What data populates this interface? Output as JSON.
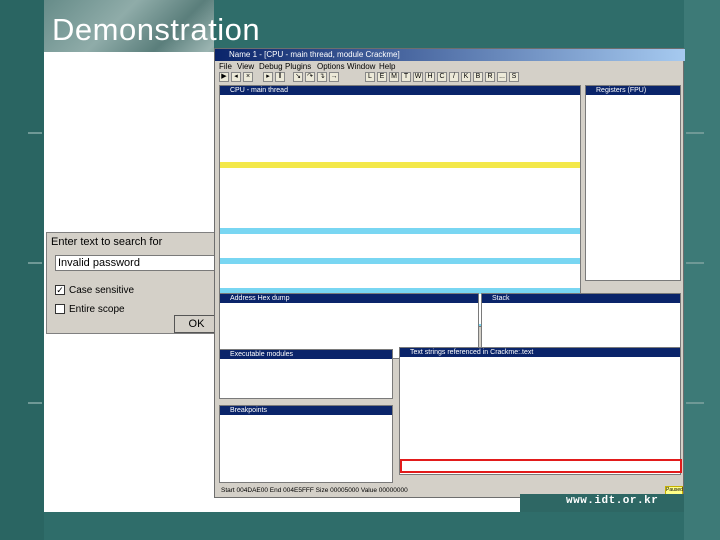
{
  "slide": {
    "title": "Demonstration",
    "brand": "www.idt.or.kr"
  },
  "search_dialog": {
    "prompt": "Enter text to search for",
    "value": "Invalid password",
    "case_sensitive_label": "Case sensitive",
    "case_sensitive_checked": true,
    "entire_scope_label": "Entire scope",
    "entire_scope_checked": false,
    "ok_label": "OK"
  },
  "debugger": {
    "title": "Name 1 - [CPU - main thread, module Crackme]",
    "menus": [
      "File",
      "View",
      "Debug",
      "Plugins",
      "Options",
      "Window",
      "Help"
    ],
    "toolbar_buttons": [
      "L",
      "E",
      "M",
      "T",
      "W",
      "H",
      "C",
      "/",
      "K",
      "B",
      "R",
      "...",
      "S"
    ],
    "panes": {
      "cpu": "CPU - main thread",
      "registers": "Registers (FPU)",
      "dump": "Address  Hex dump",
      "stack": "Stack",
      "strings": "Text strings referenced in Crackme:.text",
      "modules": "Executable modules",
      "breakpoints": "Breakpoints"
    },
    "status": "Start 004DAE00  End 004E5FFF  Size 00005000  Value 00000000",
    "paused": "Paused"
  },
  "colors": {
    "slide_bg": "#2d6b68",
    "title_text": "#ffffff",
    "highlight_box": "#e21b1b",
    "titlebar": "#0a246a"
  }
}
